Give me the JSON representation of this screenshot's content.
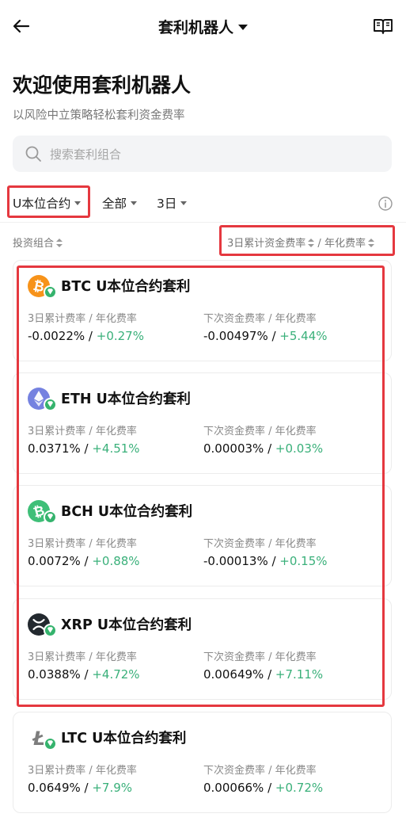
{
  "header": {
    "title": "套利机器人"
  },
  "welcome": {
    "title": "欢迎使用套利机器人",
    "subtitle": "以风险中立策略轻松套利资金费率"
  },
  "search": {
    "placeholder": "搜索套利组合"
  },
  "filters": [
    {
      "label": "U本位合约"
    },
    {
      "label": "全部"
    },
    {
      "label": "3日"
    }
  ],
  "columns": {
    "left": "投资组合",
    "right_a": "3日累计资金费率",
    "right_sep": " / ",
    "right_b": "年化费率"
  },
  "labels": {
    "left": "3日累计费率 / 年化费率",
    "right": "下次资金费率 / 年化费率"
  },
  "colors": {
    "positive": "#3ab07a",
    "highlight": "#e5383f",
    "badge": "#35b36d"
  },
  "cards": [
    {
      "coin": "BTC",
      "icon": "bitcoin-icon",
      "color": "#f7931a",
      "title": "BTC U本位合约套利",
      "cum_rate": "-0.0022%",
      "cum_annual": "+0.27%",
      "next_rate": "-0.00497%",
      "next_annual": "+5.44%"
    },
    {
      "coin": "ETH",
      "icon": "ethereum-icon",
      "color": "#7582e0",
      "title": "ETH U本位合约套利",
      "cum_rate": "0.0371%",
      "cum_annual": "+4.51%",
      "next_rate": "0.00003%",
      "next_annual": "+0.03%"
    },
    {
      "coin": "BCH",
      "icon": "bitcoin-cash-icon",
      "color": "#3fbf78",
      "title": "BCH U本位合约套利",
      "cum_rate": "0.0072%",
      "cum_annual": "+0.88%",
      "next_rate": "-0.00013%",
      "next_annual": "+0.15%"
    },
    {
      "coin": "XRP",
      "icon": "xrp-icon",
      "color": "#23292f",
      "title": "XRP U本位合约套利",
      "cum_rate": "0.0388%",
      "cum_annual": "+4.72%",
      "next_rate": "0.00649%",
      "next_annual": "+7.11%"
    },
    {
      "coin": "LTC",
      "icon": "litecoin-icon",
      "color": "#ffffff",
      "title": "LTC U本位合约套利",
      "cum_rate": "0.0649%",
      "cum_annual": "+7.9%",
      "next_rate": "0.00066%",
      "next_annual": "+0.72%"
    }
  ]
}
